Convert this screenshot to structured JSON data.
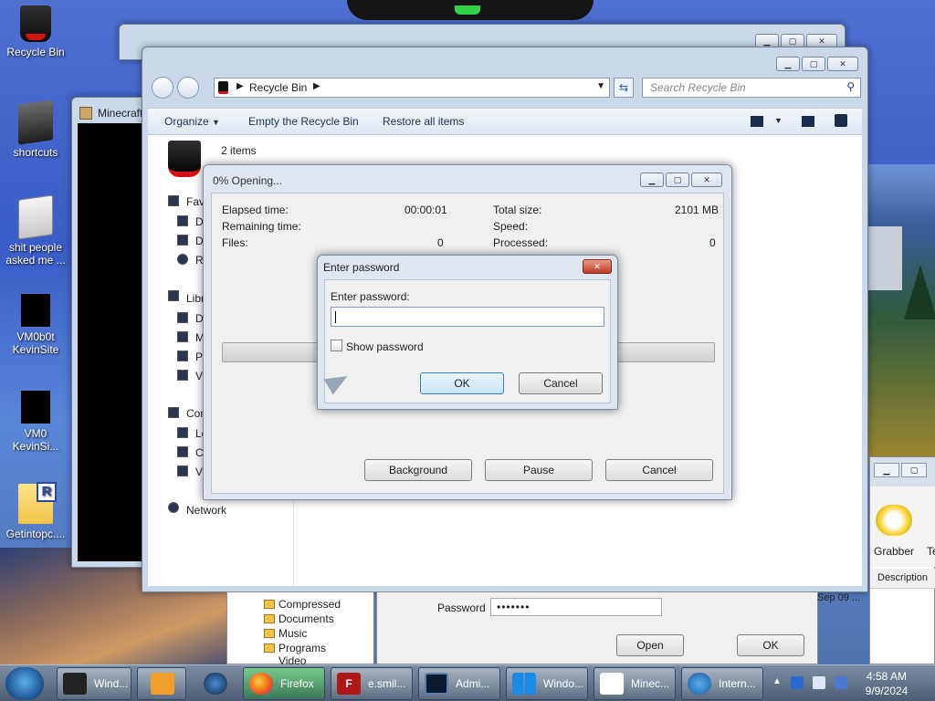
{
  "desktop": {
    "icons": [
      {
        "label": "Recycle Bin"
      },
      {
        "label": "shortcuts"
      },
      {
        "label": "shit people asked me ..."
      },
      {
        "label": "VM0b0t KevinSite"
      },
      {
        "label": "VM0 KevinSi..."
      },
      {
        "label": "Getintopc...."
      }
    ]
  },
  "minecraft_window": {
    "title": "Minecraft"
  },
  "explorer": {
    "address": "Recycle Bin",
    "search_placeholder": "Search Recycle Bin",
    "toolbar": {
      "organize": "Organize",
      "empty": "Empty the Recycle Bin",
      "restore": "Restore all items"
    },
    "item_count": "2 items",
    "nav": {
      "favorites": "Favorites",
      "libraries": "Libraries",
      "computer": "Computer",
      "network": "Network",
      "fav_items": [
        "D",
        "D",
        "R"
      ],
      "lib_items": [
        "D",
        "M",
        "P",
        "V"
      ],
      "comp_items": [
        "Lo",
        "C",
        "V"
      ]
    }
  },
  "opening_dialog": {
    "title": "0% Opening...",
    "elapsed_label": "Elapsed time:",
    "elapsed_value": "00:00:01",
    "remaining_label": "Remaining time:",
    "files_label": "Files:",
    "files_value": "0",
    "total_label": "Total size:",
    "total_value": "2101 MB",
    "speed_label": "Speed:",
    "processed_label": "Processed:",
    "processed_value": "0",
    "progress": 0,
    "background_btn": "Background",
    "pause_btn": "Pause",
    "cancel_btn": "Cancel"
  },
  "password_dialog": {
    "title": "Enter password",
    "prompt": "Enter password:",
    "value": "",
    "show_password_label": "Show password",
    "show_password_checked": false,
    "ok": "OK",
    "cancel": "Cancel"
  },
  "lower_window": {
    "tree": [
      "Compressed",
      "Documents",
      "Music",
      "Programs",
      "Video"
    ],
    "password_label": "Password",
    "password_value": "•••••••",
    "open_btn": "Open",
    "ok_btn": "OK"
  },
  "right_window": {
    "grabber": "Grabber",
    "te": "Te",
    "description": "Description",
    "date": "Sep 09 ..."
  },
  "taskbar": {
    "items": [
      {
        "label": "Wind..."
      },
      {
        "label": ""
      },
      {
        "label": ""
      },
      {
        "label": "Firefox"
      },
      {
        "label": "e.smil..."
      },
      {
        "label": "Admi..."
      },
      {
        "label": "Windo..."
      },
      {
        "label": "Minec..."
      },
      {
        "label": "Intern..."
      }
    ],
    "time": "4:58 AM",
    "date": "9/9/2024"
  },
  "colors": {
    "accent": "#3c7fb1",
    "bin_red": "#d41313",
    "close_red": "#c03a22"
  }
}
